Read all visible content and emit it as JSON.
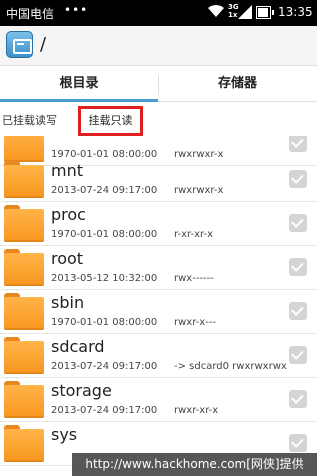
{
  "status_bar": {
    "carrier": "中国电信",
    "dots": "•••",
    "network_type": "3G",
    "network_sub": "1x",
    "time": "13:35",
    "battery_level": 0.9,
    "background": "#000000"
  },
  "app_bar": {
    "icon": "file-manager-icon",
    "path": "/"
  },
  "tabs": [
    {
      "label": "根目录",
      "active": true
    },
    {
      "label": "存储器",
      "active": false
    }
  ],
  "mount_bar": {
    "status_text": "已挂载读写",
    "button_label": "挂载只读",
    "highlight_color": "#e02020"
  },
  "files": [
    {
      "name": "",
      "date": "1970-01-01 08:00:00",
      "perm": "rwxrwxr-x"
    },
    {
      "name": "mnt",
      "date": "2013-07-24 09:17:00",
      "perm": "rwxrwxr-x"
    },
    {
      "name": "proc",
      "date": "1970-01-01 08:00:00",
      "perm": "r-xr-xr-x"
    },
    {
      "name": "root",
      "date": "2013-05-12 10:32:00",
      "perm": "rwx------"
    },
    {
      "name": "sbin",
      "date": "1970-01-01 08:00:00",
      "perm": "rwxr-x---"
    },
    {
      "name": "sdcard",
      "date": "2013-07-24 09:17:00",
      "perm": "-> sdcard0  rwxrwxrwx"
    },
    {
      "name": "storage",
      "date": "2013-07-24 09:17:00",
      "perm": "rwxr-xr-x"
    },
    {
      "name": "sys",
      "date": "",
      "perm": ""
    }
  ],
  "watermark": "http://www.hackhome.com[网侠]提供",
  "colors": {
    "accent": "#4a9ad4",
    "folder": "#f7961e"
  }
}
